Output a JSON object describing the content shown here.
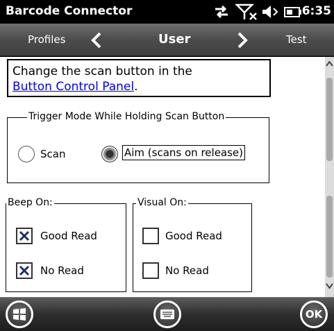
{
  "status": {
    "app_title": "Barcode Connector",
    "time": "6:35"
  },
  "nav": {
    "left_label": "Profiles",
    "current_label": "User",
    "right_label": "Test"
  },
  "info": {
    "line1": "Change the scan button in the",
    "link_text": "Button Control Panel",
    "link_suffix": "."
  },
  "trigger_mode": {
    "legend": "Trigger Mode While Holding Scan Button",
    "options": [
      {
        "label": "Scan",
        "selected": false
      },
      {
        "label": "Aim (scans on release)",
        "selected": true
      }
    ]
  },
  "beep_on": {
    "legend": "Beep On:",
    "items": [
      {
        "label": "Good Read",
        "checked": true
      },
      {
        "label": "No Read",
        "checked": true
      }
    ]
  },
  "visual_on": {
    "legend": "Visual On:",
    "items": [
      {
        "label": "Good Read",
        "checked": false
      },
      {
        "label": "No Read",
        "checked": false
      }
    ]
  },
  "bottom": {
    "ok_label": "OK"
  }
}
